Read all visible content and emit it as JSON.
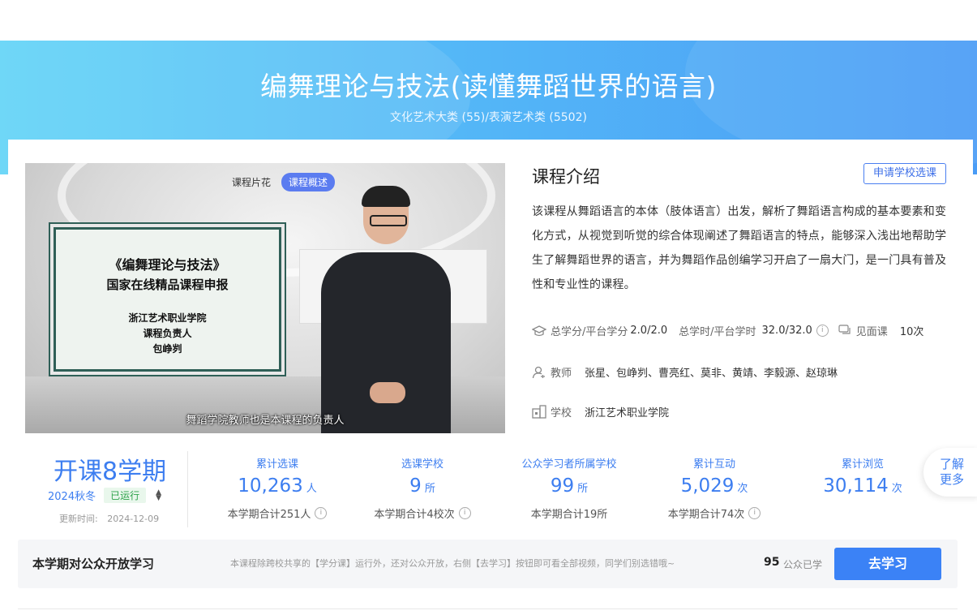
{
  "banner": {
    "title": "编舞理论与技法(读懂舞蹈世界的语言)",
    "category": "文化艺术大类 (55)/表演艺术类 (5502)"
  },
  "video": {
    "tabs": [
      "课程片花",
      "课程概述"
    ],
    "active_tab": "课程概述",
    "board_title": "《编舞理论与技法》",
    "board_line2": "国家在线精品课程申报",
    "board_line3": "浙江艺术职业学院",
    "board_line4": "课程负责人",
    "board_line5": "包峥刿",
    "subtitle": "舞蹈学院教师也是本课程的负责人"
  },
  "intro": {
    "title": "课程介绍",
    "apply_label": "申请学校选课",
    "description": "该课程从舞蹈语言的本体（肢体语言）出发，解析了舞蹈语言构成的基本要素和变化方式，从视觉到听觉的综合体现阐述了舞蹈语言的特点，能够深入浅出地帮助学生了解舞蹈世界的语言，并为舞蹈作品创编学习开启了一扇大门，是一门具有普及性和专业性的课程。"
  },
  "meta": {
    "credit_label": "总学分/平台学分",
    "credit_value": "2.0/2.0",
    "hours_label": "总学时/平台学时",
    "hours_value": "32.0/32.0",
    "meet_label": "见面课",
    "meet_value": "10次",
    "teacher_label": "教师",
    "teachers": "张星、包峥刿、曹亮红、莫非、黄靖、李毅源、赵琼琳",
    "school_label": "学校",
    "school": "浙江艺术职业学院"
  },
  "term": {
    "title": "开课8学期",
    "current": "2024秋冬",
    "status": "已运行",
    "updated_label": "更新时间:",
    "updated": "2024-12-09"
  },
  "stats": [
    {
      "label": "累计选课",
      "value": "10,263",
      "unit": "人",
      "foot": "本学期合计251人",
      "info": true
    },
    {
      "label": "选课学校",
      "value": "9",
      "unit": "所",
      "foot": "本学期合计4校次",
      "info": true
    },
    {
      "label": "公众学习者所属学校",
      "value": "99",
      "unit": "所",
      "foot": "本学期合计19所",
      "info": false
    },
    {
      "label": "累计互动",
      "value": "5,029",
      "unit": "次",
      "foot": "本学期合计74次",
      "info": true
    },
    {
      "label": "累计浏览",
      "value": "30,114",
      "unit": "次",
      "foot": "",
      "info": false
    }
  ],
  "more_label_1": "了解",
  "more_label_2": "更多",
  "open": {
    "title": "本学期对公众开放学习",
    "note": "本课程除跨校共享的【学分课】运行外，还对公众开放，右侧【去学习】按钮即可看全部视频，同学们别选错哦~",
    "count": "95",
    "count_label": "公众已学",
    "button": "去学习"
  },
  "colors": {
    "accent": "#3d7ef0",
    "banner_start": "#5fd3f7",
    "banner_end": "#4a9cf6",
    "status_green": "#2fa34b"
  }
}
